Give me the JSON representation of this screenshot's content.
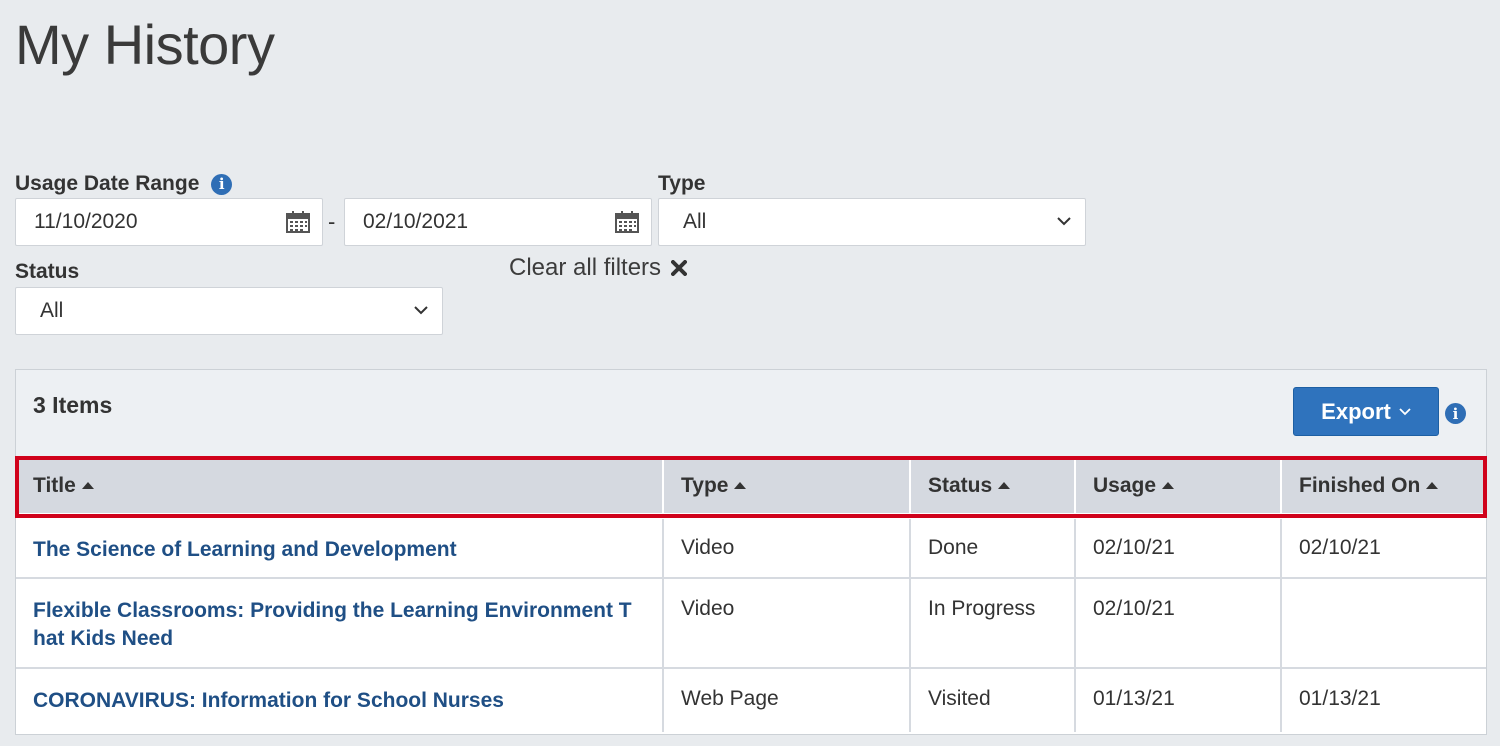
{
  "page": {
    "title": "My History"
  },
  "filters": {
    "date_range_label": "Usage Date Range",
    "date_from": "11/10/2020",
    "date_separator": "-",
    "date_to": "02/10/2021",
    "type_label": "Type",
    "type_value": "All",
    "status_label": "Status",
    "status_value": "All",
    "clear_label": "Clear all filters"
  },
  "results": {
    "count_label": "3 Items",
    "export_label": "Export",
    "columns": [
      "Title",
      "Type",
      "Status",
      "Usage",
      "Finished On"
    ],
    "rows": [
      {
        "title": "The Science of Learning and Development",
        "type": "Video",
        "status": "Done",
        "usage": "02/10/21",
        "finished_on": "02/10/21"
      },
      {
        "title": "Flexible Classrooms: Providing the Learning Environment T hat Kids Need",
        "type": "Video",
        "status": "In Progress",
        "usage": "02/10/21",
        "finished_on": ""
      },
      {
        "title": "CORONAVIRUS: Information for School Nurses",
        "type": "Web Page",
        "status": "Visited",
        "usage": "01/13/21",
        "finished_on": "01/13/21"
      }
    ]
  },
  "colors": {
    "accent": "#2f73bd",
    "link": "#1f4f85",
    "highlight": "#d0021b"
  },
  "icons": {
    "info": "info-icon",
    "calendar": "calendar-icon",
    "chevron": "chevron-down-icon",
    "close": "close-icon",
    "sort": "sort-ascending-icon"
  }
}
